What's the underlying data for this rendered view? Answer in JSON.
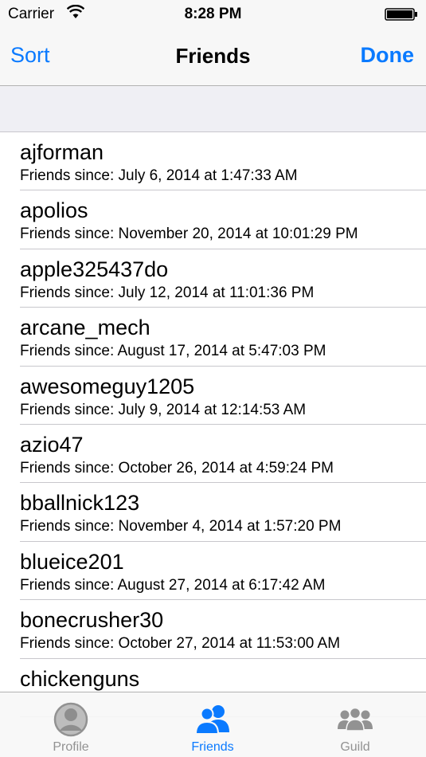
{
  "status_bar": {
    "carrier": "Carrier",
    "time": "8:28 PM"
  },
  "nav_bar": {
    "left_button": "Sort",
    "title": "Friends",
    "right_button": "Done"
  },
  "friends": [
    {
      "name": "ajforman",
      "since": "Friends since: July 6, 2014 at 1:47:33 AM"
    },
    {
      "name": "apolios",
      "since": "Friends since: November 20, 2014 at 10:01:29 PM"
    },
    {
      "name": "apple325437do",
      "since": "Friends since: July 12, 2014 at 11:01:36 PM"
    },
    {
      "name": "arcane_mech",
      "since": "Friends since: August 17, 2014 at 5:47:03 PM"
    },
    {
      "name": "awesomeguy1205",
      "since": "Friends since: July 9, 2014 at 12:14:53 AM"
    },
    {
      "name": "azio47",
      "since": "Friends since: October 26, 2014 at 4:59:24 PM"
    },
    {
      "name": "bballnick123",
      "since": "Friends since: November 4, 2014 at 1:57:20 PM"
    },
    {
      "name": "blueice201",
      "since": "Friends since: August 27, 2014 at 6:17:42 AM"
    },
    {
      "name": "bonecrusher30",
      "since": "Friends since: October 27, 2014 at 11:53:00 AM"
    },
    {
      "name": "chickenguns",
      "since": ""
    }
  ],
  "tab_bar": {
    "tabs": [
      {
        "label": "Profile",
        "icon": "person-icon"
      },
      {
        "label": "Friends",
        "icon": "people-icon"
      },
      {
        "label": "Guild",
        "icon": "group-icon"
      }
    ],
    "active_index": 1,
    "active_color": "#0a7aff",
    "inactive_color": "#929292"
  }
}
